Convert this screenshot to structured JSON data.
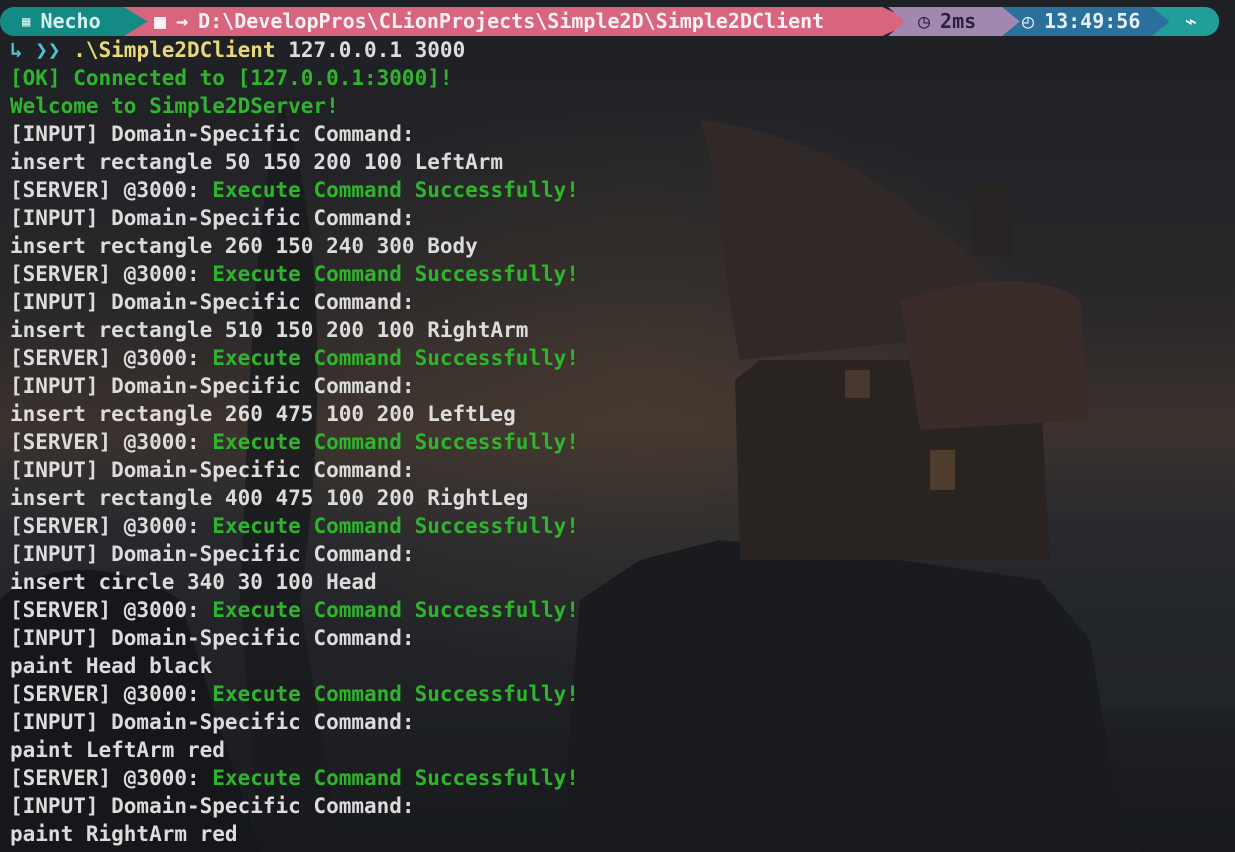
{
  "prompt": {
    "os_icon": "windows-icon",
    "user": "Necho",
    "folder_icon": "folder-icon",
    "path": "D:\\DevelopPros\\CLionProjects\\Simple2D\\Simple2DClient",
    "duration_icon": "timer-icon",
    "duration": "2ms",
    "clock_icon": "clock-icon",
    "time": "13:49:56",
    "status_icon": "pulse-icon"
  },
  "command": {
    "prefix": "↳ ❯❯",
    "executable": ".\\Simple2DClient",
    "args": "127.0.0.1",
    "port": "3000"
  },
  "output": [
    {
      "kind": "ok",
      "text": "[OK] Connected to [127.0.0.1:3000]!"
    },
    {
      "kind": "ok",
      "text": "Welcome to Simple2DServer!"
    },
    {
      "kind": "input",
      "text": "[INPUT] Domain-Specific Command:"
    },
    {
      "kind": "cmd",
      "text": "insert rectangle 50 150 200 100 LeftArm"
    },
    {
      "kind": "server",
      "prefix": "[SERVER] @3000: ",
      "text": "Execute Command Successfully!"
    },
    {
      "kind": "input",
      "text": "[INPUT] Domain-Specific Command:"
    },
    {
      "kind": "cmd",
      "text": "insert rectangle 260 150 240 300 Body"
    },
    {
      "kind": "server",
      "prefix": "[SERVER] @3000: ",
      "text": "Execute Command Successfully!"
    },
    {
      "kind": "input",
      "text": "[INPUT] Domain-Specific Command:"
    },
    {
      "kind": "cmd",
      "text": "insert rectangle 510 150 200 100 RightArm"
    },
    {
      "kind": "server",
      "prefix": "[SERVER] @3000: ",
      "text": "Execute Command Successfully!"
    },
    {
      "kind": "input",
      "text": "[INPUT] Domain-Specific Command:"
    },
    {
      "kind": "cmd",
      "text": "insert rectangle 260 475 100 200 LeftLeg"
    },
    {
      "kind": "server",
      "prefix": "[SERVER] @3000: ",
      "text": "Execute Command Successfully!"
    },
    {
      "kind": "input",
      "text": "[INPUT] Domain-Specific Command:"
    },
    {
      "kind": "cmd",
      "text": "insert rectangle 400 475 100 200 RightLeg"
    },
    {
      "kind": "server",
      "prefix": "[SERVER] @3000: ",
      "text": "Execute Command Successfully!"
    },
    {
      "kind": "input",
      "text": "[INPUT] Domain-Specific Command:"
    },
    {
      "kind": "cmd",
      "text": "insert circle 340 30 100 Head"
    },
    {
      "kind": "server",
      "prefix": "[SERVER] @3000: ",
      "text": "Execute Command Successfully!"
    },
    {
      "kind": "input",
      "text": "[INPUT] Domain-Specific Command:"
    },
    {
      "kind": "cmd",
      "text": "paint Head black"
    },
    {
      "kind": "server",
      "prefix": "[SERVER] @3000: ",
      "text": "Execute Command Successfully!"
    },
    {
      "kind": "input",
      "text": "[INPUT] Domain-Specific Command:"
    },
    {
      "kind": "cmd",
      "text": "paint LeftArm red"
    },
    {
      "kind": "server",
      "prefix": "[SERVER] @3000: ",
      "text": "Execute Command Successfully!"
    },
    {
      "kind": "input",
      "text": "[INPUT] Domain-Specific Command:"
    },
    {
      "kind": "cmd",
      "text": "paint RightArm red"
    }
  ],
  "colors": {
    "success_green": "#2fb52c",
    "os_segment": "#148a85",
    "path_segment": "#d8657d",
    "duration_segment": "#a287b1",
    "clock_segment": "#2b6f9d",
    "status_segment": "#1f9e9a"
  }
}
